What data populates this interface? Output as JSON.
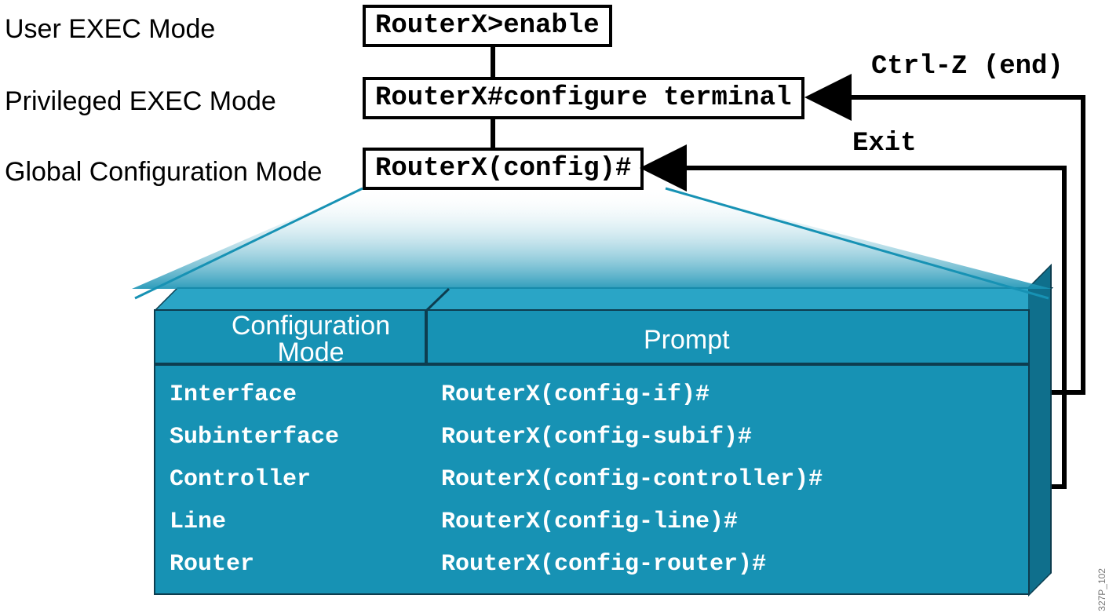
{
  "modes": {
    "user_exec_label": "User EXEC Mode",
    "user_exec_cmd": "RouterX>enable",
    "priv_exec_label": "Privileged EXEC Mode",
    "priv_exec_cmd": "RouterX#configure terminal",
    "global_cfg_label": "Global Configuration Mode",
    "global_cfg_cmd": "RouterX(config)#"
  },
  "return_labels": {
    "ctrl_z": "Ctrl-Z (end)",
    "exit": "Exit"
  },
  "table": {
    "headers": {
      "mode": "Configuration\nMode",
      "prompt": "Prompt"
    },
    "rows": [
      {
        "mode": "Interface",
        "prompt": "RouterX(config-if)#"
      },
      {
        "mode": "Subinterface",
        "prompt": "RouterX(config-subif)#"
      },
      {
        "mode": "Controller",
        "prompt": "RouterX(config-controller)#"
      },
      {
        "mode": "Line",
        "prompt": "RouterX(config-line)#"
      },
      {
        "mode": "Router",
        "prompt": "RouterX(config-router)#"
      }
    ]
  },
  "image_id": "327P_102",
  "colors": {
    "cuboid_front": "#1792b4",
    "cuboid_top": "#2aa5c6",
    "cuboid_side": "#0f6f8c",
    "cuboid_edge": "#0d3d4f"
  }
}
